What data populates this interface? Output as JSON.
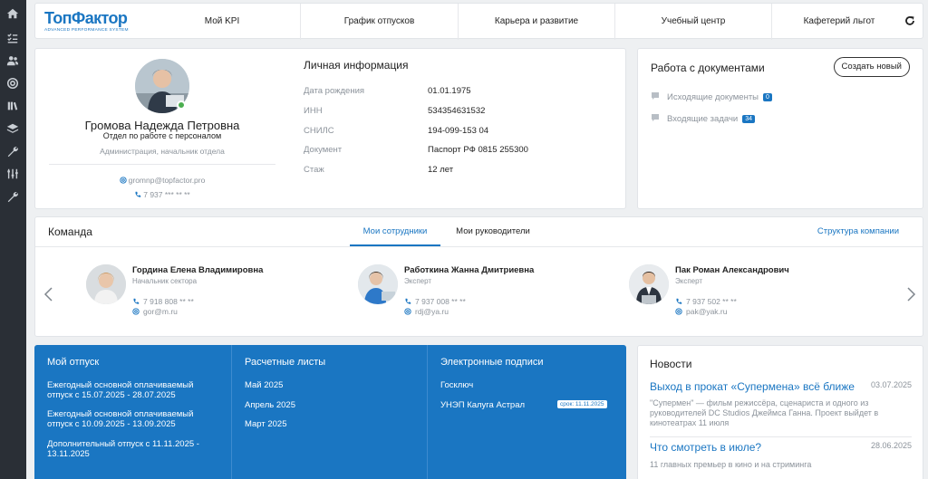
{
  "logo": {
    "main": "ТопФактор",
    "sub": "ADVANCED PERFORMANCE SYSTEM"
  },
  "nav": [
    "Мой KPI",
    "График отпусков",
    "Карьера и развитие",
    "Учебный центр",
    "Кафетерий льгот"
  ],
  "profile": {
    "name": "Громова Надежда Петровна",
    "department": "Отдел по работе с персоналом",
    "position": "Администрация, начальник отдела",
    "email": "gromnp@topfactor.pro",
    "phone": "7 937 *** ** **"
  },
  "personal_info": {
    "title": "Личная информация",
    "rows": [
      {
        "label": "Дата рождения",
        "value": "01.01.1975"
      },
      {
        "label": "ИНН",
        "value": "534354631532"
      },
      {
        "label": "СНИЛС",
        "value": "194-099-153 04"
      },
      {
        "label": "Документ",
        "value": "Паспорт РФ 0815 255300"
      },
      {
        "label": "Стаж",
        "value": "12 лет"
      }
    ]
  },
  "documents": {
    "title": "Работа с документами",
    "create_label": "Создать новый",
    "items": [
      {
        "label": "Исходящие документы",
        "count": "0"
      },
      {
        "label": "Входящие задачи",
        "count": "34"
      }
    ]
  },
  "team": {
    "title": "Команда",
    "tabs": [
      "Мои сотрудники",
      "Мои руководители"
    ],
    "structure_link": "Структура компании",
    "members": [
      {
        "name": "Гордина Елена Владимировна",
        "role": "Начальник сектора",
        "phone": "7 918 808 ** **",
        "email": "gor@m.ru"
      },
      {
        "name": "Работкина Жанна Дмитриевна",
        "role": "Эксперт",
        "phone": "7 937 008 ** **",
        "email": "rdj@ya.ru"
      },
      {
        "name": "Пак Роман Александрович",
        "role": "Эксперт",
        "phone": "7 937 502 ** **",
        "email": "pak@yak.ru"
      }
    ]
  },
  "vacation": {
    "title": "Мой отпуск",
    "items": [
      "Ежегодный основной оплачиваемый отпуск с 15.07.2025 - 28.07.2025",
      "Ежегодный основной оплачиваемый отпуск с 10.09.2025 - 13.09.2025",
      "Дополнительный отпуск с 11.11.2025 - 13.11.2025"
    ]
  },
  "payslips": {
    "title": "Расчетные листы",
    "items": [
      "Май 2025",
      "Апрель 2025",
      "Март 2025"
    ]
  },
  "signatures": {
    "title": "Электронные подписи",
    "items": [
      "Госключ",
      "УНЭП Калуга Астрал"
    ],
    "expiry": "срок: 11.11.2025"
  },
  "news": {
    "title": "Новости",
    "items": [
      {
        "title": "Выход в прокат «Супермена» всё ближе",
        "date": "03.07.2025",
        "text": "\"Супермен\" — фильм режиссёра, сценариста и одного из руководителей DC Studios Джеймса Ганна. Проект выйдет в кинотеатрах 11 июля"
      },
      {
        "title": "Что смотреть в июле?",
        "date": "28.06.2025",
        "text": "11 главных премьер в кино и на стриминга"
      }
    ]
  },
  "colors": {
    "accent": "#1a76c2",
    "sidebar": "#2a2f36",
    "online": "#4caf50"
  }
}
